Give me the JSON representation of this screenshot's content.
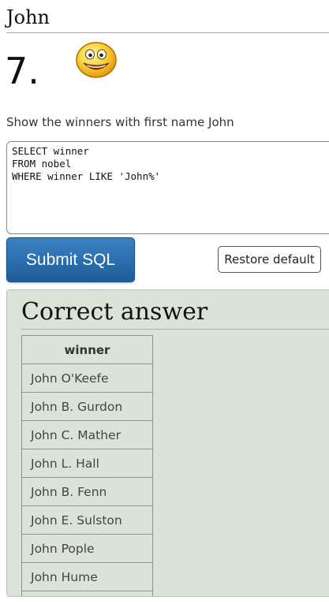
{
  "page": {
    "title": "John",
    "question_number": "7.",
    "instruction": "Show the winners with first name John"
  },
  "editor": {
    "sql": "SELECT winner\nFROM nobel\nWHERE winner LIKE 'John%'"
  },
  "buttons": {
    "submit_label": "Submit SQL",
    "restore_label": "Restore default"
  },
  "answer": {
    "heading": "Correct answer",
    "columns": [
      "winner"
    ],
    "rows": [
      "John O'Keefe",
      "John B. Gurdon",
      "John C. Mather",
      "John L. Hall",
      "John B. Fenn",
      "John E. Sulston",
      "John Pople",
      "John Hume",
      ""
    ]
  },
  "icons": {
    "status": "smiley-face-icon"
  },
  "colors": {
    "submit_button": "#2b6cad",
    "answer_panel": "#dbe3d8"
  }
}
